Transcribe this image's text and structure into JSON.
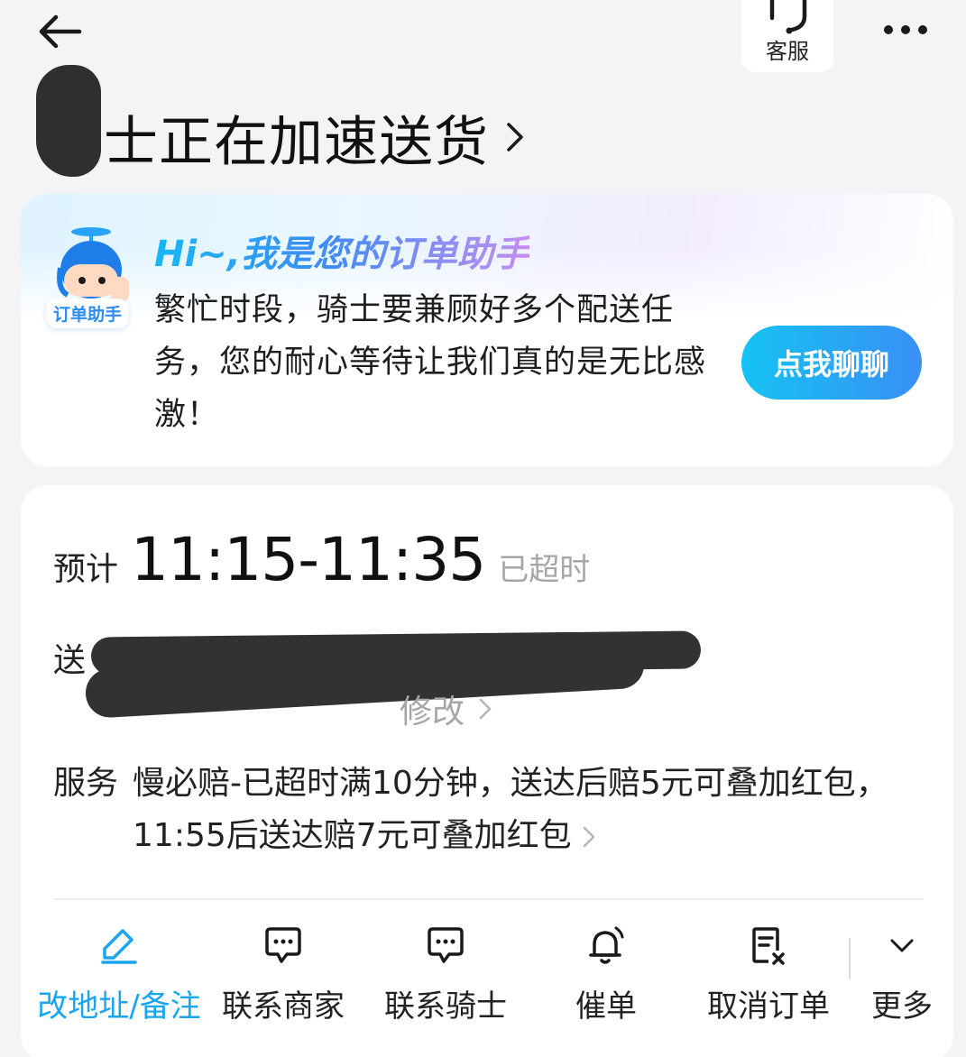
{
  "header": {
    "service_label": "客服",
    "status_title": "骑士正在加速送货"
  },
  "assistant": {
    "badge": "订单助手",
    "greeting": "Hi~,我是您的订单助手",
    "message": "繁忙时段，骑士要兼顾好多个配送任务，您的耐心等待让我们真的是无比感激！",
    "chat_button": "点我聊聊"
  },
  "delivery": {
    "eta_label": "预计",
    "eta_time": "11:15-11:35",
    "eta_status": "已超时",
    "address_label": "送",
    "address_edit": "修改",
    "service_label": "服务",
    "service_text": "慢必赔-已超时满10分钟，送达后赔5元可叠加红包，11:55后送达赔7元可叠加红包"
  },
  "actions": [
    {
      "label": "改地址/备注",
      "icon": "edit-address-icon"
    },
    {
      "label": "联系商家",
      "icon": "chat-merchant-icon"
    },
    {
      "label": "联系骑士",
      "icon": "chat-rider-icon"
    },
    {
      "label": "催单",
      "icon": "bell-icon"
    },
    {
      "label": "取消订单",
      "icon": "cancel-order-icon"
    },
    {
      "label": "更多",
      "icon": "chevron-down-icon"
    }
  ],
  "colors": {
    "accent": "#19a6ef",
    "button_gradient_start": "#15c3f3",
    "button_gradient_end": "#3a8ff5",
    "muted_text": "#a6a6a6"
  }
}
